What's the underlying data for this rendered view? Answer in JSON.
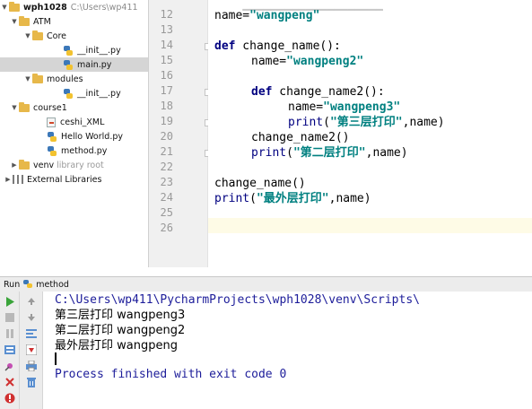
{
  "tree": {
    "root_name": "wph1028",
    "root_path": "C:\\Users\\wp411",
    "items": [
      {
        "label": "ATM"
      },
      {
        "label": "Core"
      },
      {
        "label": "__init__.py"
      },
      {
        "label": "main.py"
      },
      {
        "label": "modules"
      },
      {
        "label": "__init__.py"
      },
      {
        "label": "course1"
      },
      {
        "label": "ceshi_XML"
      },
      {
        "label": "Hello World.py"
      },
      {
        "label": "method.py"
      },
      {
        "label": "venv",
        "suffix": "library root"
      },
      {
        "label": "External Libraries"
      }
    ]
  },
  "editor": {
    "line_numbers": [
      "12",
      "13",
      "14",
      "15",
      "16",
      "17",
      "18",
      "19",
      "20",
      "21",
      "22",
      "23",
      "24",
      "25",
      "26"
    ],
    "lines": {
      "l12_name": "name=",
      "l12_str": "\"wangpeng\"",
      "l14_def": "def",
      "l14_rest": " change_name():",
      "l15_name": "name=",
      "l15_str": "\"wangpeng2\"",
      "l17_def": "def",
      "l17_rest": " change_name2():",
      "l18_name": "name=",
      "l18_str": "\"wangpeng3\"",
      "l19_print": "print",
      "l19_open": "(",
      "l19_str": "\"第三层打印\"",
      "l19_close": ",name)",
      "l20_call": "change_name2()",
      "l21_print": "print",
      "l21_open": "(",
      "l21_str": "\"第二层打印\"",
      "l21_close": ",name)",
      "l23_call": "change_name()",
      "l24_print": "print",
      "l24_open": "(",
      "l24_str": "\"最外层打印\"",
      "l24_close": ",name)"
    }
  },
  "run_panel": {
    "tab_label": "Run",
    "config_name": "method",
    "output": [
      "C:\\Users\\wp411\\PycharmProjects\\wph1028\\venv\\Scripts\\",
      "第三层打印 wangpeng3",
      "第二层打印 wangpeng2",
      "最外层打印 wangpeng",
      "Process finished with exit code 0"
    ]
  },
  "icons": {
    "run": "play-icon",
    "stop": "stop-icon",
    "pause": "pause-icon",
    "rerun": "rerun-icon",
    "scroll_up": "arrow-up-icon",
    "scroll_down": "arrow-down-icon",
    "soft_wrap": "soft-wrap-icon",
    "print": "print-icon",
    "trash": "trash-icon",
    "close": "close-icon",
    "help": "help-icon",
    "pin": "pin-icon"
  },
  "colors": {
    "keyword": "#000080",
    "string": "#008080",
    "console_system": "#1d1d9a",
    "caret_line": "#fefbe6",
    "selection": "#d5d5d5",
    "run_green": "#3aa43a"
  }
}
